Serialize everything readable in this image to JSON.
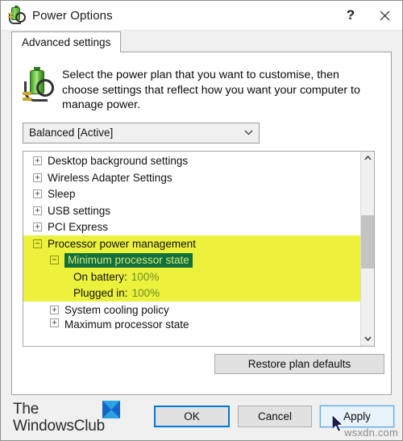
{
  "window": {
    "title": "Power Options",
    "icon": "power-plug-battery-icon",
    "help_label": "?",
    "close_label": "✕"
  },
  "tabs": [
    {
      "label": "Advanced settings",
      "active": true
    }
  ],
  "header": {
    "description": "Select the power plan that you want to customise, then choose settings that reflect how you want your computer to manage power.",
    "icon": "battery-plug-icon"
  },
  "plan_select": {
    "value": "Balanced [Active]",
    "arrow": "⌄",
    "options": [
      "Balanced [Active]"
    ]
  },
  "tree": {
    "rows": [
      {
        "indent": 0,
        "expander": "+",
        "label": "Desktop background settings",
        "highlight": false,
        "selected": false
      },
      {
        "indent": 0,
        "expander": "+",
        "label": "Wireless Adapter Settings",
        "highlight": false,
        "selected": false
      },
      {
        "indent": 0,
        "expander": "+",
        "label": "Sleep",
        "highlight": false,
        "selected": false
      },
      {
        "indent": 0,
        "expander": "+",
        "label": "USB settings",
        "highlight": false,
        "selected": false
      },
      {
        "indent": 0,
        "expander": "+",
        "label": "PCI Express",
        "highlight": false,
        "selected": false
      },
      {
        "indent": 0,
        "expander": "−",
        "label": "Processor power management",
        "highlight": true,
        "selected": false
      },
      {
        "indent": 1,
        "expander": "−",
        "label": "Minimum processor state",
        "highlight": true,
        "selected": true
      },
      {
        "indent": 2,
        "expander": "",
        "label": "On battery:",
        "value": "100%",
        "highlight": true,
        "selected": false
      },
      {
        "indent": 2,
        "expander": "",
        "label": "Plugged in:",
        "value": "100%",
        "highlight": true,
        "selected": false
      },
      {
        "indent": 1,
        "expander": "+",
        "label": "System cooling policy",
        "highlight": false,
        "selected": false
      },
      {
        "indent": 1,
        "expander": "+",
        "label": "Maximum processor state",
        "highlight": false,
        "selected": false,
        "clipped": true
      }
    ],
    "scrollbar": {
      "up": "∧",
      "down": "∨"
    }
  },
  "buttons": {
    "restore": "Restore plan defaults",
    "ok": "OK",
    "cancel": "Cancel",
    "apply": "Apply"
  },
  "branding": {
    "line1": "The",
    "line2": "WindowsClub",
    "watermark": "wsxdn.com"
  },
  "colors": {
    "highlight_yellow": "#ecf13c",
    "selection_green": "#11703b",
    "selection_text": "#d7ea7e",
    "value_text": "#6b8f2a",
    "focus_blue": "#0078d7",
    "apply_fill": "#e8f2fb"
  }
}
